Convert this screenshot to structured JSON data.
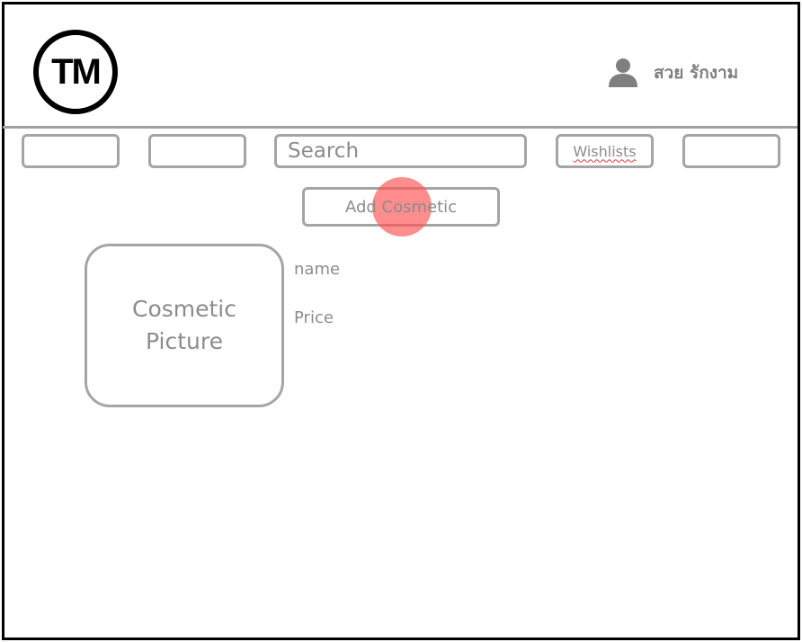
{
  "header": {
    "logo_text": "TM",
    "user_name": "สวย รักงาม",
    "user_icon": "user-icon"
  },
  "nav": {
    "button_1": "",
    "button_2": "",
    "search_label": "Search",
    "wishlists_label": "Wishlists",
    "button_5": ""
  },
  "actions": {
    "add_cosmetic_label": "Add Cosmetic",
    "click_marker_color": "#ff5050"
  },
  "cosmetic": {
    "picture_line_1": "Cosmetic",
    "picture_line_2": "Picture",
    "name_label": "name",
    "price_label": "Price"
  }
}
